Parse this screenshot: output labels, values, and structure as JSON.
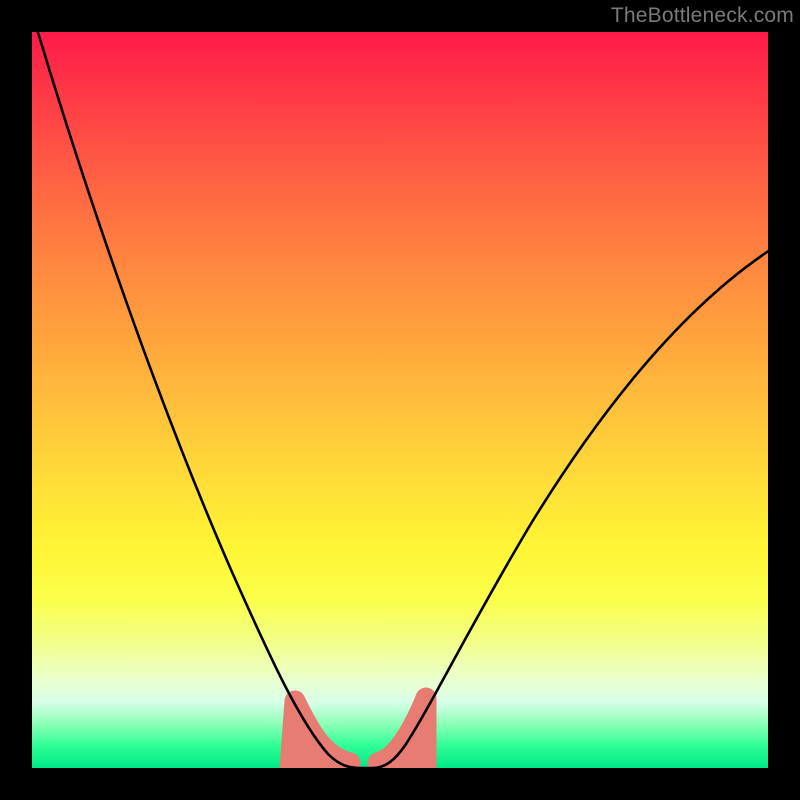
{
  "watermark": "TheBottleneck.com",
  "chart_data": {
    "type": "line",
    "title": "",
    "xlabel": "",
    "ylabel": "",
    "xlim": [
      0,
      100
    ],
    "ylim": [
      0,
      100
    ],
    "series": [
      {
        "name": "bottleneck-curve",
        "x": [
          0,
          5,
          10,
          15,
          20,
          25,
          30,
          33,
          36,
          38,
          40,
          42,
          44,
          46,
          48,
          52,
          56,
          60,
          65,
          70,
          75,
          80,
          85,
          90,
          95,
          100
        ],
        "values": [
          100,
          84,
          68,
          53,
          40,
          28,
          17,
          11,
          6,
          3,
          1,
          0,
          0,
          0,
          2,
          8,
          15,
          22,
          30,
          37,
          44,
          50,
          56,
          61,
          66,
          70
        ]
      }
    ],
    "highlight_bands": [
      {
        "name": "left-cusp",
        "x_start": 36,
        "x_end": 41,
        "y_start": 0,
        "y_end": 7
      },
      {
        "name": "right-cusp",
        "x_start": 46,
        "x_end": 51,
        "y_start": 0,
        "y_end": 9
      }
    ],
    "gradient_stops": [
      {
        "pos": 0,
        "color": "#ff1a49"
      },
      {
        "pos": 50,
        "color": "#ffc63b"
      },
      {
        "pos": 75,
        "color": "#fbff4a"
      },
      {
        "pos": 100,
        "color": "#00e886"
      }
    ],
    "colors": {
      "curve": "#000000",
      "highlight": "#e77d72",
      "background_frame": "#000000"
    }
  }
}
